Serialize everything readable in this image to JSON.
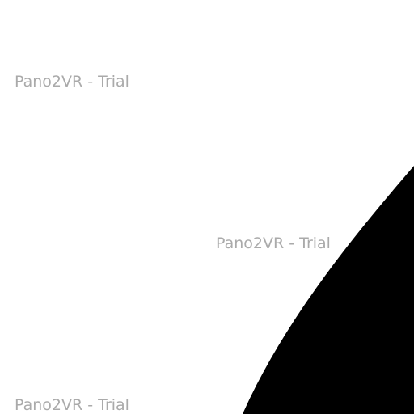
{
  "watermarks": [
    "Pano2VR - Trial",
    "Pano2VR - Trial",
    "Pano2VR - Trial"
  ],
  "colors": {
    "background": "#ffffff",
    "shape_fill": "#000000",
    "watermark_text": "#aaaaaa"
  }
}
